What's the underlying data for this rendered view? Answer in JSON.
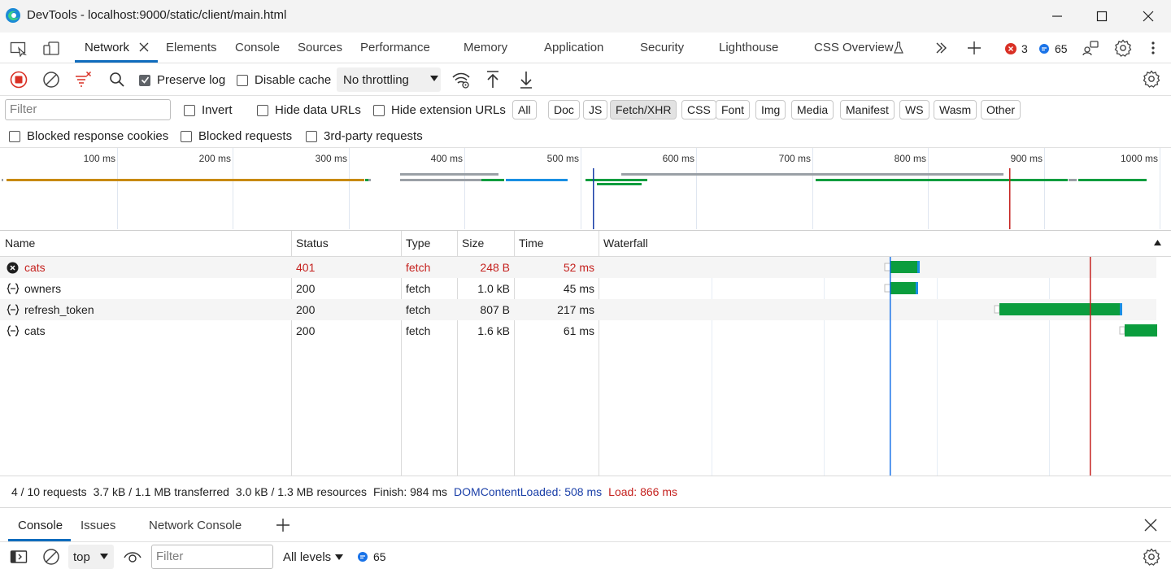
{
  "window": {
    "title": "DevTools - localhost:9000/static/client/main.html"
  },
  "tabs": [
    {
      "label": "Network"
    },
    {
      "label": "Elements"
    },
    {
      "label": "Console"
    },
    {
      "label": "Sources"
    },
    {
      "label": "Performance"
    },
    {
      "label": "Memory"
    },
    {
      "label": "Application"
    },
    {
      "label": "Security"
    },
    {
      "label": "Lighthouse"
    },
    {
      "label": "CSS Overview"
    }
  ],
  "badges": {
    "errors": "3",
    "messages": "65"
  },
  "toolbar": {
    "preserve_log": "Preserve log",
    "preserve_log_checked": true,
    "disable_cache": "Disable cache",
    "throttling": "No throttling"
  },
  "filter": {
    "placeholder": "Filter",
    "invert": "Invert",
    "hide_data_urls": "Hide data URLs",
    "hide_extension_urls": "Hide extension URLs",
    "types": [
      "All",
      "Doc",
      "JS",
      "Fetch/XHR",
      "CSS",
      "Font",
      "Img",
      "Media",
      "Manifest",
      "WS",
      "Wasm",
      "Other"
    ],
    "selected_type": "Fetch/XHR",
    "blocked_response_cookies": "Blocked response cookies",
    "blocked_requests": "Blocked requests",
    "third_party": "3rd-party requests"
  },
  "overview": {
    "ticks": [
      "100 ms",
      "200 ms",
      "300 ms",
      "400 ms",
      "500 ms",
      "600 ms",
      "700 ms",
      "800 ms",
      "900 ms",
      "1000 ms"
    ]
  },
  "table": {
    "headers": {
      "name": "Name",
      "status": "Status",
      "type": "Type",
      "size": "Size",
      "time": "Time",
      "waterfall": "Waterfall"
    },
    "rows": [
      {
        "name": "cats",
        "status": "401",
        "type": "fetch",
        "size": "248 B",
        "time": "52 ms",
        "error": true
      },
      {
        "name": "owners",
        "status": "200",
        "type": "fetch",
        "size": "1.0 kB",
        "time": "45 ms",
        "error": false
      },
      {
        "name": "refresh_token",
        "status": "200",
        "type": "fetch",
        "size": "807 B",
        "time": "217 ms",
        "error": false
      },
      {
        "name": "cats",
        "status": "200",
        "type": "fetch",
        "size": "1.6 kB",
        "time": "61 ms",
        "error": false
      }
    ]
  },
  "summary": {
    "requests": "4 / 10 requests",
    "transferred": "3.7 kB / 1.1 MB transferred",
    "resources": "3.0 kB / 1.3 MB resources",
    "finish": "Finish: 984 ms",
    "dom_content_loaded": "DOMContentLoaded: 508 ms",
    "load": "Load: 866 ms"
  },
  "drawer": {
    "tabs": [
      "Console",
      "Issues",
      "Network Console"
    ],
    "context": "top",
    "filter_placeholder": "Filter",
    "levels": "All levels",
    "messages": "65"
  },
  "colors": {
    "accent": "#0f6cbd",
    "error": "#c5221f",
    "dcl": "#1a3fa8",
    "load": "#c5221f",
    "waiting": "#0b9d3e",
    "download": "#1a8fe3"
  }
}
